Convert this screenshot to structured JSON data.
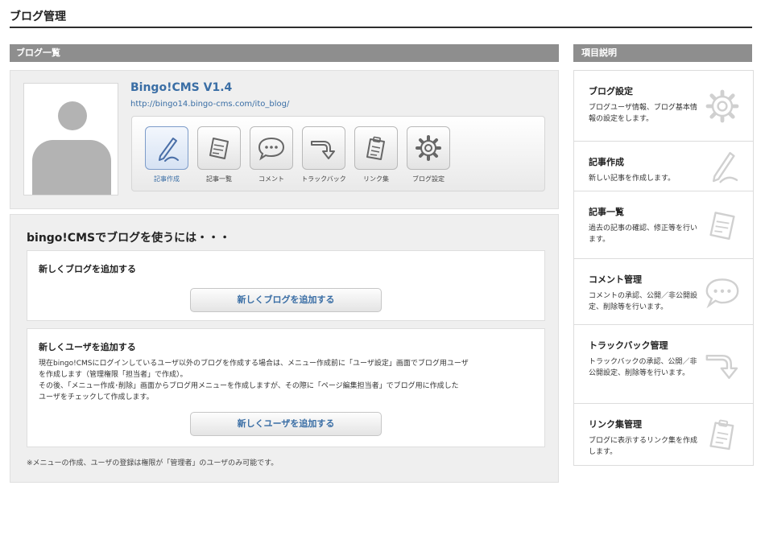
{
  "page_title": "ブログ管理",
  "left_header": "ブログ一覧",
  "blog": {
    "name": "Bingo!CMS V1.4",
    "url": "http://bingo14.bingo-cms.com/ito_blog/",
    "tools": [
      {
        "label": "記事作成",
        "icon": "pencil-icon"
      },
      {
        "label": "記事一覧",
        "icon": "notepad-icon"
      },
      {
        "label": "コメント",
        "icon": "speech-bubble-icon"
      },
      {
        "label": "トラックバック",
        "icon": "trackback-arrow-icon"
      },
      {
        "label": "リンク集",
        "icon": "clipboard-icon"
      },
      {
        "label": "ブログ設定",
        "icon": "gear-icon"
      }
    ]
  },
  "how_to": {
    "title": "bingo!CMSでブログを使うには・・・",
    "add_blog": {
      "title": "新しくブログを追加する",
      "button": "新しくブログを追加する"
    },
    "add_user": {
      "title": "新しくユーザを追加する",
      "lines": [
        "現在bingo!CMSにログインしているユーザ以外のブログを作成する場合は、メニュー作成前に「ユーザ設定」画面でブログ用ユーザ",
        "を作成します（管理権限「担当者」で作成）。",
        "その後、「メニュー作成･削除」画面からブログ用メニューを作成しますが、その際に「ページ編集担当者」でブログ用に作成した",
        "ユーザをチェックして作成します。"
      ],
      "button": "新しくユーザを追加する"
    },
    "note": "※メニューの作成、ユーザの登録は権限が「管理者」のユーザのみ可能です。"
  },
  "right_header": "項目説明",
  "help": [
    {
      "title": "ブログ設定",
      "desc": "ブログユーザ情報、ブログ基本情報の設定をします。",
      "icon": "gear-icon"
    },
    {
      "title": "記事作成",
      "desc": "新しい記事を作成します。",
      "icon": "pencil-icon"
    },
    {
      "title": "記事一覧",
      "desc": "過去の記事の確認、修正等を行います。",
      "icon": "notepad-icon"
    },
    {
      "title": "コメント管理",
      "desc": "コメントの承認、公開／非公開設定、削除等を行います。",
      "icon": "speech-bubble-icon"
    },
    {
      "title": "トラックバック管理",
      "desc": "トラックバックの承認、公開／非公開設定、削除等を行います。",
      "icon": "trackback-arrow-icon"
    },
    {
      "title": "リンク集管理",
      "desc": "ブログに表示するリンク集を作成します。",
      "icon": "clipboard-icon"
    }
  ],
  "colors": {
    "link": "#3a6ea5",
    "header_bar": "#8e8e8e",
    "panel": "#efefef"
  }
}
